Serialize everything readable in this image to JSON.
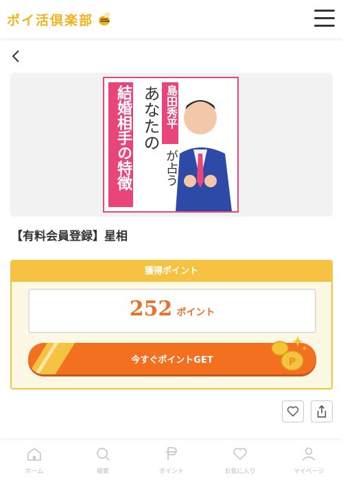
{
  "header": {
    "logo_text": "ポイ活倶楽部",
    "logo_icon": "bee-icon",
    "menu_icon": "hamburger-icon"
  },
  "nav": {
    "back_icon": "chevron-left-icon"
  },
  "banner": {
    "left_text": "結婚相手の特徴",
    "mid_text": "あなたの",
    "right_text": "島田秀平",
    "right_text2": "が占う"
  },
  "offer": {
    "title": "【有料会員登録】星相"
  },
  "points": {
    "header": "獲得ポイント",
    "value": "252",
    "unit": "ポイント",
    "get_label": "今すぐポイントGET"
  },
  "actions": {
    "favorite_icon": "heart-icon",
    "share_icon": "share-icon"
  },
  "bottom_nav": [
    {
      "label": "ホーム",
      "icon": "home-icon"
    },
    {
      "label": "検索",
      "icon": "search-icon"
    },
    {
      "label": "ポイント",
      "icon": "point-icon"
    },
    {
      "label": "お気に入り",
      "icon": "heart-icon"
    },
    {
      "label": "マイページ",
      "icon": "user-icon"
    }
  ],
  "colors": {
    "brand_yellow": "#f3b21b",
    "accent_orange": "#f27020",
    "banner_pink": "#e8457a"
  }
}
